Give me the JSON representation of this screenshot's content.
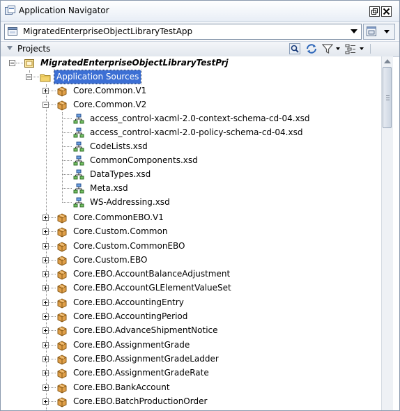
{
  "window": {
    "title": "Application Navigator"
  },
  "app_selector": {
    "value": "MigratedEnterpriseObjectLibraryTestApp"
  },
  "projects": {
    "label": "Projects"
  },
  "icons": {
    "title": "app-navigator-icon",
    "restore": "restore-icon",
    "close": "close-icon",
    "app": "application-icon",
    "app_menu": "application-menu-icon",
    "find": "find-icon",
    "sync": "sync-icon",
    "filter": "filter-icon",
    "options": "options-icon",
    "project": "project-icon",
    "folder": "folder-icon",
    "package": "package-icon",
    "xsd": "xsd-schema-icon"
  },
  "colors": {
    "selection": "#3c6fd4",
    "package": "#c98a2e",
    "folder": "#f3d36b"
  },
  "tree": {
    "root": {
      "label": "MigratedEnterpriseObjectLibraryTestPrj"
    },
    "app_sources": {
      "label": "Application Sources"
    },
    "packages_top": [
      {
        "label": "Core.Common.V1"
      },
      {
        "label": "Core.Common.V2"
      }
    ],
    "xsd_files": [
      {
        "label": "access_control-xacml-2.0-context-schema-cd-04.xsd"
      },
      {
        "label": "access_control-xacml-2.0-policy-schema-cd-04.xsd"
      },
      {
        "label": "CodeLists.xsd"
      },
      {
        "label": "CommonComponents.xsd"
      },
      {
        "label": "DataTypes.xsd"
      },
      {
        "label": "Meta.xsd"
      },
      {
        "label": "WS-Addressing.xsd"
      }
    ],
    "packages_rest": [
      {
        "label": "Core.CommonEBO.V1"
      },
      {
        "label": "Core.Custom.Common"
      },
      {
        "label": "Core.Custom.CommonEBO"
      },
      {
        "label": "Core.Custom.EBO"
      },
      {
        "label": "Core.EBO.AccountBalanceAdjustment"
      },
      {
        "label": "Core.EBO.AccountGLElementValueSet"
      },
      {
        "label": "Core.EBO.AccountingEntry"
      },
      {
        "label": "Core.EBO.AccountingPeriod"
      },
      {
        "label": "Core.EBO.AdvanceShipmentNotice"
      },
      {
        "label": "Core.EBO.AssignmentGrade"
      },
      {
        "label": "Core.EBO.AssignmentGradeLadder"
      },
      {
        "label": "Core.EBO.AssignmentGradeRate"
      },
      {
        "label": "Core.EBO.BankAccount"
      },
      {
        "label": "Core.EBO.BatchProductionOrder"
      }
    ]
  }
}
